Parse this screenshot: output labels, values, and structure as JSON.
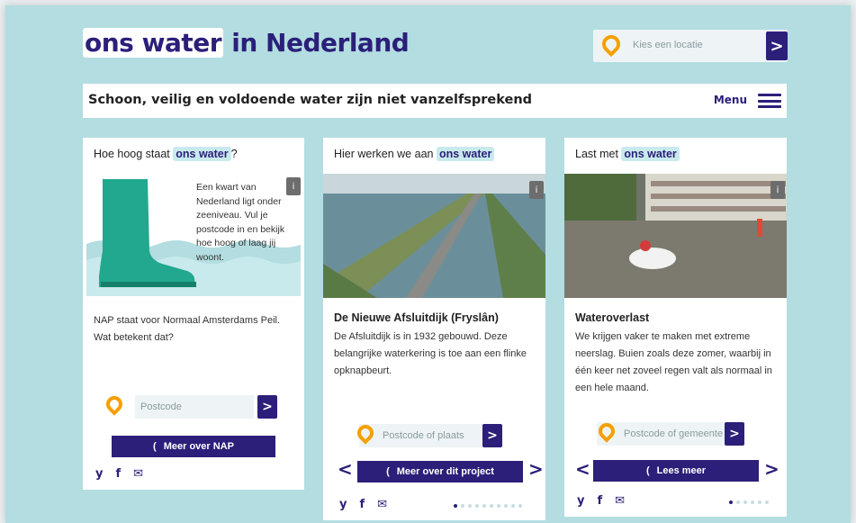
{
  "header": {
    "logo_part1": "ons water",
    "logo_part2": " in Nederland",
    "location_placeholder": "Kies een locatie",
    "tagline": "Schoon, veilig en voldoende water zijn niet vanzelfsprekend",
    "menu_label": "Menu"
  },
  "cards": [
    {
      "title_prefix": "Hoe hoog staat ",
      "title_highlight": "ons water",
      "title_suffix": "?",
      "illustration_text": "Een kwart van Nederland ligt onder zeeniveau. Vul je postcode in en bekijk hoe hoog of laag jij woont.",
      "body": "NAP staat voor Normaal Amsterdams Peil. Wat betekent dat?",
      "input_placeholder": "Postcode",
      "cta_label": "Meer over NAP",
      "cta_icon": "(",
      "go_icon": ">"
    },
    {
      "title_prefix": "Hier werken we aan ",
      "title_highlight": "ons water",
      "headline": "De Nieuwe Afsluitdijk (Fryslân)",
      "body": "De Afsluitdijk is in 1932 gebouwd. Deze belangrijke waterkering is toe aan een flinke opknapbeurt.",
      "input_placeholder": "Postcode of plaats",
      "cta_label": "Meer over dit project",
      "cta_icon": "(",
      "prev": "<",
      "next": ">",
      "go_icon": ">",
      "dots_total": 10,
      "dots_active": 0
    },
    {
      "title_prefix": "Last met ",
      "title_highlight": "ons water",
      "headline": "Wateroverlast",
      "body": "We krijgen vaker te maken met extreme neerslag. Buien zoals deze zomer, waarbij in één keer net zoveel regen valt als normaal in een hele maand.",
      "input_placeholder": "Postcode of gemeente",
      "cta_label": "Lees meer",
      "cta_icon": "(",
      "prev": "<",
      "next": ">",
      "go_icon": ">",
      "dots_total": 6,
      "dots_active": 0
    }
  ],
  "social": {
    "twitter": "y",
    "facebook": "f",
    "mail": "✉"
  },
  "icons": [
    "location-pin-icon",
    "chevron-right-icon",
    "hamburger-icon",
    "twitter-icon",
    "facebook-icon",
    "mail-icon",
    "photo-info-icon"
  ],
  "colors": {
    "brand": "#2b1f7a",
    "accent": "#f5a000",
    "background": "#b3dde0",
    "highlight": "#c8eaed"
  }
}
